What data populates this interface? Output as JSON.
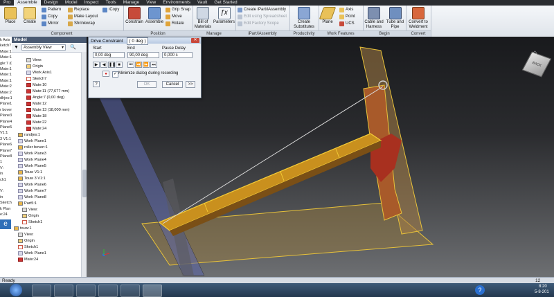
{
  "ribbon": {
    "tabs": [
      "Pro",
      "Assemble",
      "Design",
      "Model",
      "Inspect",
      "Tools",
      "Manage",
      "View",
      "Environments",
      "Vault",
      "Get Started"
    ],
    "active_tab": "Assemble",
    "component": {
      "place": "Place",
      "create": "Create",
      "pattern": "Pattern",
      "copy": "Copy",
      "mirror": "Mirror",
      "replace": "Replace",
      "make_layout": "Make Layout",
      "shrinkwrap": "Shrinkwrap",
      "icopy": "iCopy",
      "title": "Component"
    },
    "position": {
      "constrain": "Constrain",
      "assemble": "Assemble",
      "grip_snap": "Grip Snap",
      "move": "Move",
      "rotate": "Rotate",
      "title": "Position"
    },
    "manage": {
      "bom": "Bill of Materials",
      "parameters": "Parameters",
      "title": "Manage"
    },
    "ipart": {
      "create_ipart": "Create iPart/iAssembly",
      "edit_spreadsheet": "Edit using Spreadsheet",
      "edit_factory": "Edit Factory Scope",
      "title": "iPart/iAssembly"
    },
    "productivity": {
      "create_substitutes": "Create Substitutes",
      "title": "Productivity"
    },
    "work_features": {
      "plane": "Plane",
      "axis": "Axis",
      "point": "Point",
      "ucs": "UCS",
      "title": "Work Features"
    },
    "begin": {
      "cable": "Cable and Harness",
      "tube": "Tube and Pipe",
      "title": "Begin"
    },
    "convert": {
      "weldment": "Convert to Weldment",
      "title": "Convert"
    }
  },
  "left_strip": [
    "k Axis",
    "ketch7",
    "Mate:10",
    "Mate:11",
    "gle:7 (0,0",
    "Mate:12",
    "Mate:13 (",
    "Mate:18",
    "Mate:22",
    "Mate:24",
    "dlrjes:1",
    "Plane1",
    "r boven:1",
    "Plane3",
    "Plane4",
    "Plane5",
    "V1:1",
    "3 V1:1",
    "Plane6",
    "Plane7",
    "Plane8",
    "1",
    "V:",
    "in",
    "ch1",
    "",
    "V:",
    "in",
    "Sketch",
    "k Plan",
    "e:24"
  ],
  "browser": {
    "title": "Model",
    "view_label": "Assembly View",
    "nodes": [
      {
        "label": "View:",
        "indent": 3,
        "icon": "view"
      },
      {
        "label": "Origin",
        "indent": 3,
        "icon": "origin"
      },
      {
        "label": "Work Axis1",
        "indent": 3,
        "icon": "plane"
      },
      {
        "label": "Sketch7",
        "indent": 3,
        "icon": "sketch"
      },
      {
        "label": "Mate:10",
        "indent": 3,
        "icon": "mate"
      },
      {
        "label": "Mate:11 (77,677 mm)",
        "indent": 3,
        "icon": "mate"
      },
      {
        "label": "Angle:7 (0,00 deg)",
        "indent": 3,
        "icon": "mate"
      },
      {
        "label": "Mate:12",
        "indent": 3,
        "icon": "mate"
      },
      {
        "label": "Mate:13 (18,000 mm)",
        "indent": 3,
        "icon": "mate"
      },
      {
        "label": "Mate:18",
        "indent": 3,
        "icon": "mate"
      },
      {
        "label": "Mate:22",
        "indent": 3,
        "icon": "mate"
      },
      {
        "label": "Mate:24",
        "indent": 3,
        "icon": "mate"
      },
      {
        "label": "randjes:1",
        "indent": 1,
        "icon": "part"
      },
      {
        "label": "Work Plane1",
        "indent": 1,
        "icon": "plane"
      },
      {
        "label": "roller boven:1",
        "indent": 1,
        "icon": "part"
      },
      {
        "label": "Work Plane3",
        "indent": 1,
        "icon": "plane"
      },
      {
        "label": "Work Plane4",
        "indent": 1,
        "icon": "plane"
      },
      {
        "label": "Work Plane5",
        "indent": 1,
        "icon": "plane"
      },
      {
        "label": "Touw V1:1",
        "indent": 1,
        "icon": "part"
      },
      {
        "label": "Touw 3 V1:1",
        "indent": 1,
        "icon": "part"
      },
      {
        "label": "Work Plane6",
        "indent": 1,
        "icon": "plane"
      },
      {
        "label": "Work Plane7",
        "indent": 1,
        "icon": "plane"
      },
      {
        "label": "Work Plane8",
        "indent": 1,
        "icon": "plane"
      },
      {
        "label": "Part5:1",
        "indent": 1,
        "icon": "part"
      },
      {
        "label": "View:",
        "indent": 2,
        "icon": "view"
      },
      {
        "label": "Origin",
        "indent": 2,
        "icon": "origin"
      },
      {
        "label": "Sketch1",
        "indent": 2,
        "icon": "sketch"
      },
      {
        "label": "touw:1",
        "indent": 0,
        "icon": "part"
      },
      {
        "label": "View:",
        "indent": 1,
        "icon": "view"
      },
      {
        "label": "Origin",
        "indent": 1,
        "icon": "origin"
      },
      {
        "label": "Sketch1",
        "indent": 1,
        "icon": "sketch"
      },
      {
        "label": "Work Plane1",
        "indent": 1,
        "icon": "plane"
      },
      {
        "label": "Mate:24",
        "indent": 1,
        "icon": "mate"
      }
    ]
  },
  "dialog": {
    "title": "Drive Constraint",
    "title_value": "( 0 deg )",
    "start_label": "Start",
    "start_value": "0,00 deg",
    "end_label": "End",
    "end_value": "90,00 deg",
    "pause_label": "Pause Delay",
    "pause_value": "0,000 s",
    "minimize_label": "Minimize dialog during recording",
    "minimize_checked": true,
    "ok": "OK",
    "cancel": "Cancel",
    "more": ">>"
  },
  "viewcube": {
    "label": "BACK"
  },
  "status": {
    "text": "Ready",
    "count": "12"
  },
  "taskbar": {
    "time": "8:20",
    "date": "5-8-201"
  }
}
